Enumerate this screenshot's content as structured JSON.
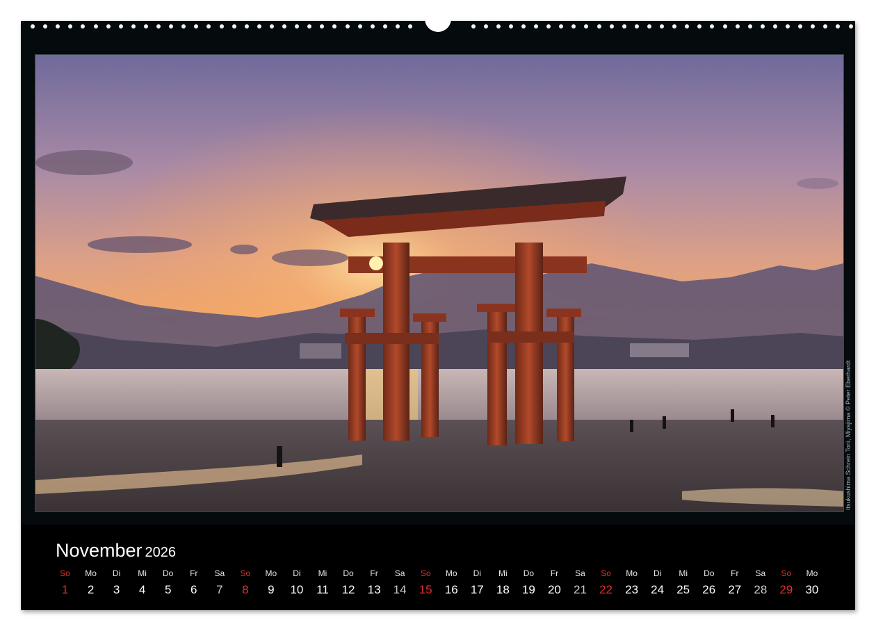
{
  "calendar": {
    "month": "November",
    "year": "2026",
    "photo_caption": "Itsukushima Schrein Torii, Miyajima © Peter Eberhardt",
    "days": [
      {
        "weekday": "So",
        "day": "1",
        "type": "sun"
      },
      {
        "weekday": "Mo",
        "day": "2",
        "type": "week"
      },
      {
        "weekday": "Di",
        "day": "3",
        "type": "week"
      },
      {
        "weekday": "Mi",
        "day": "4",
        "type": "week"
      },
      {
        "weekday": "Do",
        "day": "5",
        "type": "week"
      },
      {
        "weekday": "Fr",
        "day": "6",
        "type": "week"
      },
      {
        "weekday": "Sa",
        "day": "7",
        "type": "sat"
      },
      {
        "weekday": "So",
        "day": "8",
        "type": "sun"
      },
      {
        "weekday": "Mo",
        "day": "9",
        "type": "week"
      },
      {
        "weekday": "Di",
        "day": "10",
        "type": "week"
      },
      {
        "weekday": "Mi",
        "day": "11",
        "type": "week"
      },
      {
        "weekday": "Do",
        "day": "12",
        "type": "week"
      },
      {
        "weekday": "Fr",
        "day": "13",
        "type": "week"
      },
      {
        "weekday": "Sa",
        "day": "14",
        "type": "sat"
      },
      {
        "weekday": "So",
        "day": "15",
        "type": "sun"
      },
      {
        "weekday": "Mo",
        "day": "16",
        "type": "week"
      },
      {
        "weekday": "Di",
        "day": "17",
        "type": "week"
      },
      {
        "weekday": "Mi",
        "day": "18",
        "type": "week"
      },
      {
        "weekday": "Do",
        "day": "19",
        "type": "week"
      },
      {
        "weekday": "Fr",
        "day": "20",
        "type": "week"
      },
      {
        "weekday": "Sa",
        "day": "21",
        "type": "sat"
      },
      {
        "weekday": "So",
        "day": "22",
        "type": "sun"
      },
      {
        "weekday": "Mo",
        "day": "23",
        "type": "week"
      },
      {
        "weekday": "Di",
        "day": "24",
        "type": "week"
      },
      {
        "weekday": "Mi",
        "day": "25",
        "type": "week"
      },
      {
        "weekday": "Do",
        "day": "26",
        "type": "week"
      },
      {
        "weekday": "Fr",
        "day": "27",
        "type": "week"
      },
      {
        "weekday": "Sa",
        "day": "28",
        "type": "sat"
      },
      {
        "weekday": "So",
        "day": "29",
        "type": "sun"
      },
      {
        "weekday": "Mo",
        "day": "30",
        "type": "week"
      }
    ]
  },
  "colors": {
    "sunday_red": "#e0302d",
    "strip_background": "#000000",
    "frame_background": "#050a0c"
  }
}
